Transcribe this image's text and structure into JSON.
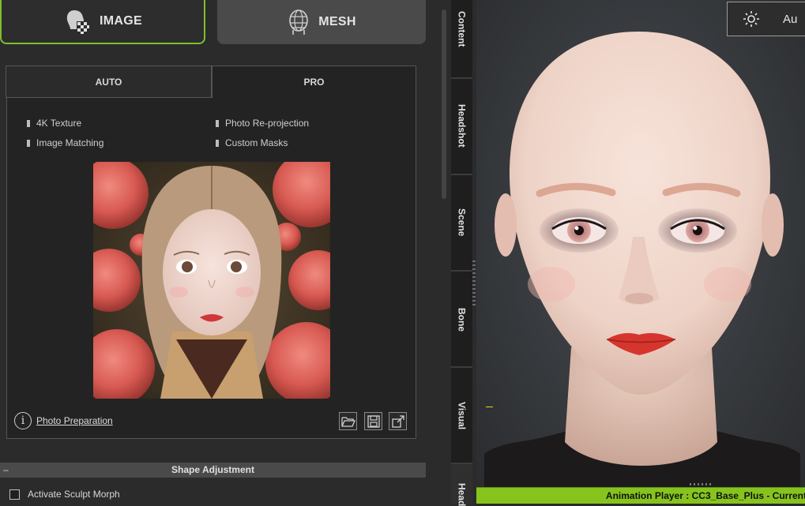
{
  "mode_buttons": {
    "image_label": "IMAGE",
    "mesh_label": "MESH"
  },
  "tabs": {
    "auto": "AUTO",
    "pro": "PRO"
  },
  "features": [
    "4K Texture",
    "Photo Re-projection",
    "Image Matching",
    "Custom Masks"
  ],
  "photo_preparation": "Photo Preparation",
  "tool_icons": [
    "folder-open-icon",
    "save-icon",
    "export-icon"
  ],
  "shape_adjustment": {
    "title": "Shape Adjustment",
    "collapse_symbol": "–"
  },
  "sculpt": {
    "label": "Activate Sculpt Morph",
    "checked": false
  },
  "side_tabs": [
    "Content",
    "Headshot",
    "Scene",
    "Bone",
    "Visual",
    "Head"
  ],
  "viewport": {
    "light_label": "Au"
  },
  "animation_bar": {
    "text": "Animation Player : CC3_Base_Plus - Current"
  },
  "colors": {
    "accent_green": "#86c41d",
    "image_border": "#7fbf2a",
    "panel_bg": "#2b2b2b"
  }
}
